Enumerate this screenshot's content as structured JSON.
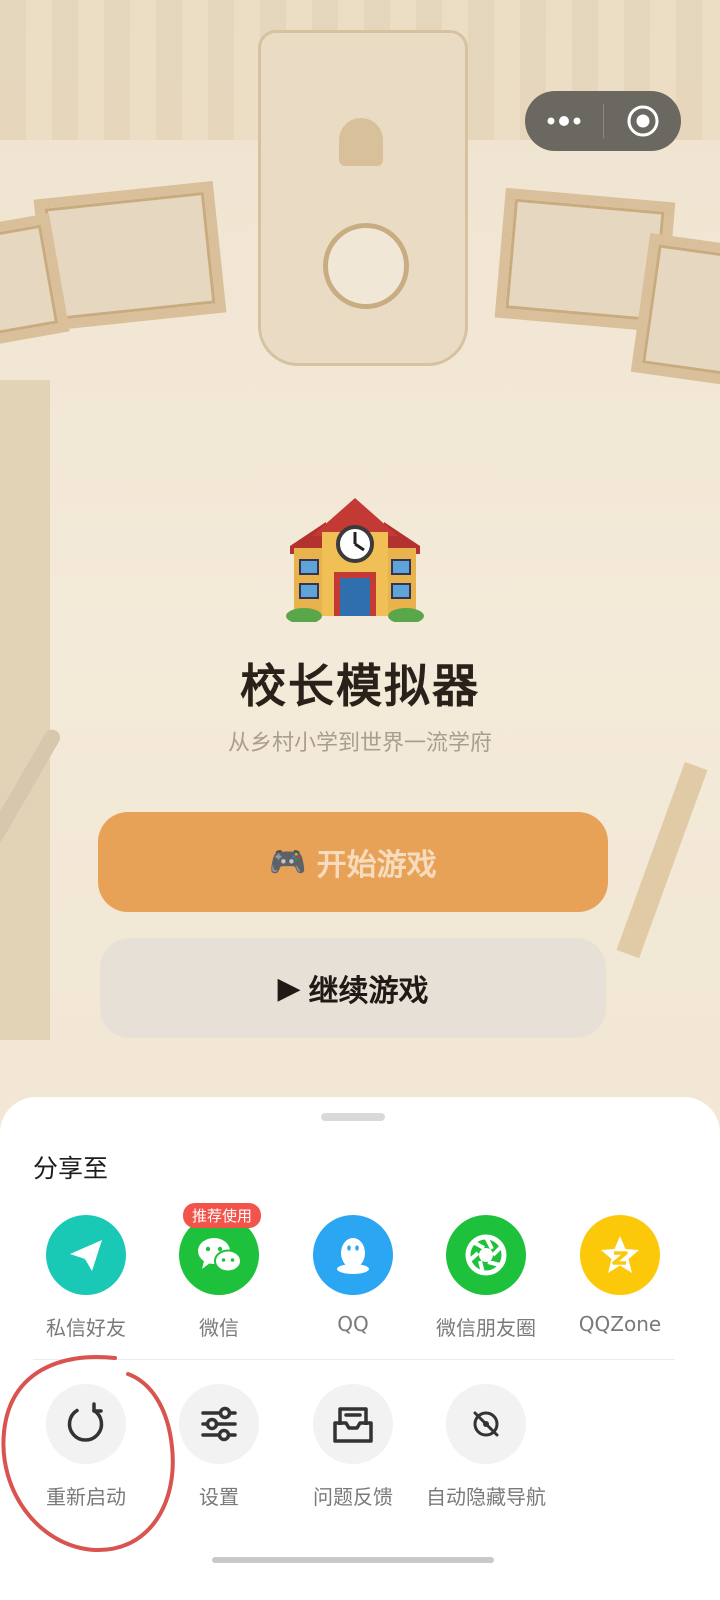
{
  "game": {
    "title": "校长模拟器",
    "subtitle": "从乡村小学到世界一流学府",
    "start_button": "开始游戏",
    "start_icon": "🎮",
    "continue_button": "继续游戏",
    "continue_icon": "▶"
  },
  "capsule": {
    "more_icon": "more-dots-icon",
    "close_icon": "close-target-icon"
  },
  "share_sheet": {
    "title": "分享至",
    "share_targets": [
      {
        "label": "私信好友",
        "icon": "paper-plane-icon",
        "color": "#19c9b6"
      },
      {
        "label": "微信",
        "icon": "wechat-icon",
        "color": "#1dc13b",
        "badge": "推荐使用"
      },
      {
        "label": "QQ",
        "icon": "qq-penguin-icon",
        "color": "#2aa6f3"
      },
      {
        "label": "微信朋友圈",
        "icon": "moments-shutter-icon",
        "color": "#1dc13b"
      },
      {
        "label": "QQZone",
        "icon": "qqzone-star-icon",
        "color": "#fbc80a"
      }
    ],
    "actions": [
      {
        "label": "重新启动",
        "icon": "restart-icon"
      },
      {
        "label": "设置",
        "icon": "settings-sliders-icon"
      },
      {
        "label": "问题反馈",
        "icon": "feedback-inbox-icon"
      },
      {
        "label": "自动隐藏导航",
        "icon": "hide-navigation-icon"
      }
    ]
  },
  "colors": {
    "start_button": "#e8a257",
    "annotation": "#d9534f",
    "action_circle": "#f2f2f2"
  }
}
